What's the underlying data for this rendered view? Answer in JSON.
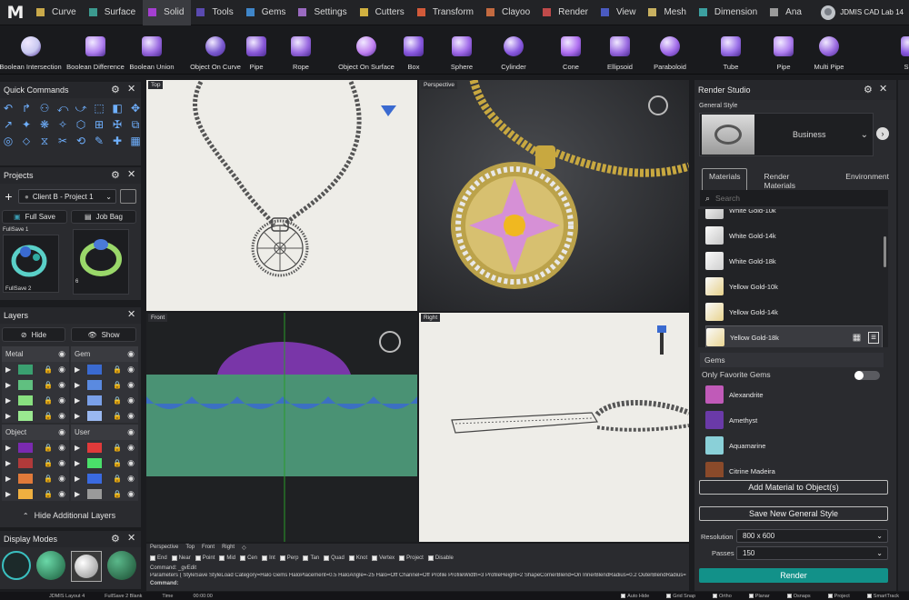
{
  "app": {
    "logo": "M",
    "user": "JDMIS CAD Lab 14"
  },
  "menu": {
    "tabs": [
      {
        "label": "Curve",
        "color": "#c9a94a"
      },
      {
        "label": "Surface",
        "color": "#3c9a8f"
      },
      {
        "label": "Solid",
        "color": "#a43fd0",
        "active": true
      },
      {
        "label": "Tools",
        "color": "#5a4ab0"
      },
      {
        "label": "Gems",
        "color": "#3f86c9"
      },
      {
        "label": "Settings",
        "color": "#9a6ac0"
      },
      {
        "label": "Cutters",
        "color": "#d0b040"
      },
      {
        "label": "Transform",
        "color": "#d25a3a"
      },
      {
        "label": "Clayoo",
        "color": "#c36a40"
      },
      {
        "label": "Render",
        "color": "#c04a4a"
      },
      {
        "label": "View",
        "color": "#4a5ac0"
      },
      {
        "label": "Mesh",
        "color": "#c8b060"
      },
      {
        "label": "Dimension",
        "color": "#3ca0a0"
      },
      {
        "label": "Ana",
        "color": "#9a9a9a"
      }
    ]
  },
  "ribbon": {
    "tools": [
      {
        "label": "Boolean Intersection",
        "icon": "boolean-intersection-icon"
      },
      {
        "label": "Boolean Difference",
        "icon": "boolean-difference-icon"
      },
      {
        "label": "Boolean Union",
        "icon": "boolean-union-icon"
      },
      {
        "label": "Object On Curve",
        "icon": "object-on-curve-icon"
      },
      {
        "label": "Pipe",
        "icon": "pipe-icon"
      },
      {
        "label": "Rope",
        "icon": "rope-icon"
      },
      {
        "label": "Object On Surface",
        "icon": "object-on-surface-icon"
      },
      {
        "label": "Box",
        "icon": "box-icon"
      },
      {
        "label": "Sphere",
        "icon": "sphere-icon"
      },
      {
        "label": "Cylinder",
        "icon": "cylinder-icon"
      },
      {
        "label": "Cone",
        "icon": "cone-icon"
      },
      {
        "label": "Ellipsoid",
        "icon": "ellipsoid-icon"
      },
      {
        "label": "Paraboloid",
        "icon": "paraboloid-icon"
      },
      {
        "label": "Tube",
        "icon": "tube-icon"
      },
      {
        "label": "Pipe",
        "icon": "pipe-icon"
      },
      {
        "label": "Multi Pipe",
        "icon": "multi-pipe-icon"
      },
      {
        "label": "Slab",
        "icon": "slab-icon"
      }
    ]
  },
  "quick_commands": {
    "title": "Quick Commands"
  },
  "projects": {
    "title": "Projects",
    "selected": "Client B - Project 1",
    "full_save": "Full Save",
    "job_bag": "Job Bag",
    "thumbs": [
      {
        "label": "FullSave 1"
      },
      {
        "label": "FullSave 2"
      },
      {
        "label": "6"
      }
    ]
  },
  "layers": {
    "title": "Layers",
    "hide": "Hide",
    "show": "Show",
    "groups": [
      {
        "name": "Metal",
        "colors": [
          "#3aa070",
          "#60c080",
          "#88e080",
          "#9ae890"
        ]
      },
      {
        "name": "Gem",
        "colors": [
          "#3a6ad0",
          "#5a8ae0",
          "#7aa0e8",
          "#9ab8f0"
        ]
      },
      {
        "name": "Object",
        "colors": [
          "#7a2ab0",
          "#b03a3a",
          "#e07a3a",
          "#f0b040"
        ]
      },
      {
        "name": "User",
        "colors": [
          "#e03a3a",
          "#4ae06a",
          "#3a6ae0",
          "#9a9a9a"
        ]
      }
    ],
    "hide_additional": "Hide Additional Layers"
  },
  "display_modes": {
    "title": "Display Modes"
  },
  "viewports": {
    "top": "Top",
    "perspective": "Perspective",
    "front": "Front",
    "right": "Right"
  },
  "view_tabs": [
    "Perspective",
    "Top",
    "Front",
    "Right"
  ],
  "snaps": [
    "End",
    "Near",
    "Point",
    "Mid",
    "Cen",
    "Int",
    "Perp",
    "Tan",
    "Quad",
    "Knot",
    "Vertex",
    "Project",
    "Disable"
  ],
  "command_lines": [
    "Command: _gvEdit",
    "Parameters ( StyleSave  StyleLoad  Category=Halo  Gems  HaloPlacement=0.5  HaloAngle=-25  Halo=Off  Channel=Off  Profile  ProfileWidth=3  ProfileHeight=2  ShapeCornerBlend=On  InnerBlendRadius=0.2  OuterBlendRadius=0.2"
  ],
  "command_prompt": "Command:",
  "render_studio": {
    "title": "Render Studio",
    "general_style_label": "General Style",
    "style_value": "Business",
    "tabs": [
      "Materials",
      "Render Materials",
      "Environment"
    ],
    "search_placeholder": "Search",
    "materials": [
      {
        "name": "White Gold-10k",
        "color": "#bdbdbd"
      },
      {
        "name": "White Gold-14k",
        "color": "#c6c6c6"
      },
      {
        "name": "White Gold-18k",
        "color": "#cfcfcf"
      },
      {
        "name": "Yellow Gold-10k",
        "color": "#e6d08a"
      },
      {
        "name": "Yellow Gold-14k",
        "color": "#e8d38e"
      },
      {
        "name": "Yellow Gold-18k",
        "color": "#ead592",
        "selected": true
      }
    ],
    "gems_header": "Gems",
    "only_favorite": "Only Favorite Gems",
    "gems": [
      {
        "name": "Alexandrite",
        "color": "#c05ab8"
      },
      {
        "name": "Amethyst",
        "color": "#6a3aa8"
      },
      {
        "name": "Aquamarine",
        "color": "#8ad0d8"
      },
      {
        "name": "Citrine Madeira",
        "color": "#8a4a2a"
      }
    ],
    "add_material": "Add Material to Object(s)",
    "save_style": "Save New General Style",
    "resolution_label": "Resolution",
    "resolution_value": "800 x 600",
    "passes_label": "Passes",
    "passes_value": "150",
    "render_button": "Render"
  },
  "statusbar": {
    "items": [
      "JDMIS Layout 4",
      "FullSave 2 Blank",
      "Time",
      "00:00:00"
    ],
    "toggles": [
      "Auto Hide",
      "Grid Snap",
      "Ortho",
      "Planar",
      "Osnaps",
      "Project",
      "SmartTrack"
    ]
  }
}
